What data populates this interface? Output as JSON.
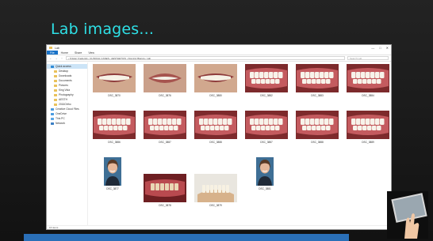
{
  "slide": {
    "title": "Lab images..."
  },
  "window": {
    "title": "Lab",
    "controls": [
      "—",
      "□",
      "✕"
    ]
  },
  "ribbon": {
    "tabs": [
      "File",
      "Home",
      "Share",
      "View"
    ]
  },
  "address_bar": {
    "back": "←",
    "forward": "→",
    "up": "↑",
    "path": "› Kristen Frederick › CLINICAL CASES › AESTHETICS › Dominic Bianca › Lab",
    "search_placeholder": "Search Lab"
  },
  "nav_pane": {
    "items": [
      {
        "label": "Quick access",
        "icon": "star-icon",
        "level": 0,
        "selected": true
      },
      {
        "label": "Desktop",
        "icon": "folder-icon",
        "level": 1
      },
      {
        "label": "Downloads",
        "icon": "folder-icon",
        "level": 1
      },
      {
        "label": "Documents",
        "icon": "folder-icon",
        "level": 1
      },
      {
        "label": "Pictures",
        "icon": "folder-icon",
        "level": 1
      },
      {
        "label": "King Vida",
        "icon": "folder-icon",
        "level": 1
      },
      {
        "label": "Photography",
        "icon": "folder-icon",
        "level": 1
      },
      {
        "label": "AESTH",
        "icon": "folder-icon",
        "level": 1
      },
      {
        "label": "2016Ortho",
        "icon": "folder-icon",
        "level": 1
      },
      {
        "label": "Creative Cloud Files",
        "icon": "cloud-icon",
        "level": 0
      },
      {
        "label": "OneDrive",
        "icon": "cloud-icon",
        "level": 0
      },
      {
        "label": "This PC",
        "icon": "computer-icon",
        "level": 0
      },
      {
        "label": "Network",
        "icon": "network-icon",
        "level": 0
      }
    ]
  },
  "files": [
    {
      "name": "DSC_3870",
      "kind": "smile"
    },
    {
      "name": "DSC_3876",
      "kind": "lips"
    },
    {
      "name": "DSC_3880",
      "kind": "smile"
    },
    {
      "name": "DSC_3882",
      "kind": "teeth"
    },
    {
      "name": "DSC_3883",
      "kind": "teeth"
    },
    {
      "name": "DSC_3884",
      "kind": "teeth"
    },
    {
      "name": "DSC_3886",
      "kind": "teeth"
    },
    {
      "name": "DSC_3887",
      "kind": "teeth"
    },
    {
      "name": "DSC_3888",
      "kind": "teeth"
    },
    {
      "name": "DSC_3887",
      "kind": "teeth"
    },
    {
      "name": "DSC_3888",
      "kind": "teeth"
    },
    {
      "name": "DSC_3889",
      "kind": "teeth"
    },
    {
      "name": "DSC_3877",
      "kind": "portrait"
    },
    {
      "name": "DSC_3878",
      "kind": "prep"
    },
    {
      "name": "DSC_3879",
      "kind": "model"
    },
    {
      "name": "DSC_3881",
      "kind": "portrait"
    }
  ],
  "status_bar": {
    "text": "16 items"
  },
  "colors": {
    "title_color": "#2ee0e6",
    "accent_bar": "#2a6fb7",
    "ribbon_file_tab": "#1a73c8"
  }
}
